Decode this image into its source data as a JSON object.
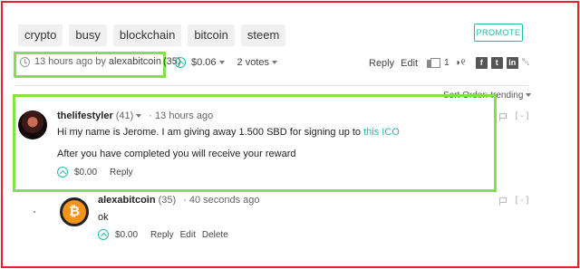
{
  "tags": [
    "crypto",
    "busy",
    "blockchain",
    "bitcoin",
    "steem"
  ],
  "promote_label": "PROMOTE",
  "post": {
    "time_text": "13 hours ago by",
    "author": "alexabitcoin",
    "rep": "(35)",
    "payout": "$0.06",
    "votes": "2 votes",
    "reply_label": "Reply",
    "edit_label": "Edit",
    "resteem_count": "1",
    "views": "◑ ୧",
    "social": [
      "f",
      "t",
      "in"
    ],
    "link_glyph": "␀"
  },
  "sort_label": "Sort Order:  trending",
  "comments": [
    {
      "author": "thelifestyler",
      "rep": "(41)",
      "time": "· 13 hours ago",
      "body_prefix": "Hi my name is Jerome. I am giving away 1.500 SBD for signing up to ",
      "body_link": "this ICO",
      "body2": "After you have completed you will receive your reward",
      "payout": "$0.00",
      "reply_label": "Reply",
      "collapse": "[-]"
    },
    {
      "author": "alexabitcoin",
      "rep": "(35)",
      "time": "· 40 seconds ago",
      "body": "ok",
      "payout": "$0.00",
      "reply_label": "Reply",
      "edit_label": "Edit",
      "delete_label": "Delete",
      "collapse": "[-]"
    }
  ],
  "colors": {
    "accent": "#1fbfa6",
    "highlight": "#7ee14e",
    "frame": "#e02424"
  }
}
